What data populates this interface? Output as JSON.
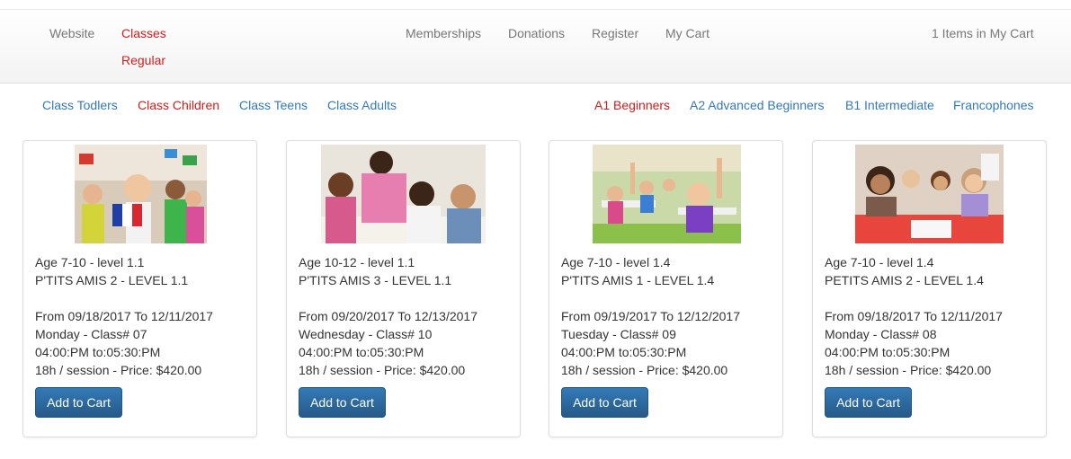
{
  "nav": {
    "website": "Website",
    "classes": "Classes",
    "regular": "Regular",
    "memberships": "Memberships",
    "donations": "Donations",
    "register": "Register",
    "my_cart": "My Cart",
    "cart_count": "1 Items in My Cart"
  },
  "subnav": {
    "left": [
      "Class Todlers",
      "Class Children",
      "Class Teens",
      "Class Adults"
    ],
    "right": [
      "A1 Beginners",
      "A2 Advanced Beginners",
      "B1 Intermediate",
      "Francophones"
    ],
    "active_left": "Class Children",
    "active_right": "A1 Beginners"
  },
  "colors": {
    "active": "#d11c1c",
    "link": "#337ab7",
    "nav_text": "#777777",
    "button": "#2a6aa6"
  },
  "cards": [
    {
      "age": "Age 7-10 - level 1.1",
      "name": "P'TITS AMIS 2 - LEVEL 1.1",
      "dates": "From 09/18/2017 To 12/11/2017",
      "day": "Monday - Class# 07",
      "time": "04:00:PM to:05:30:PM",
      "price": "18h / session - Price: $420.00",
      "button": "Add to Cart"
    },
    {
      "age": "Age 10-12 - level 1.1",
      "name": "P'TITS AMIS 3 - LEVEL 1.1",
      "dates": "From 09/20/2017 To 12/13/2017",
      "day": "Wednesday - Class# 10",
      "time": "04:00:PM to:05:30:PM",
      "price": "18h / session - Price: $420.00",
      "button": "Add to Cart"
    },
    {
      "age": "Age 7-10 - level 1.4",
      "name": "P'TITS AMIS 1 - LEVEL 1.4",
      "dates": "From 09/19/2017 To 12/12/2017",
      "day": "Tuesday - Class# 09",
      "time": "04:00:PM to:05:30:PM",
      "price": "18h / session - Price: $420.00",
      "button": "Add to Cart"
    },
    {
      "age": "Age 7-10 - level 1.4",
      "name": "PETITS AMIS 2 - LEVEL 1.4",
      "dates": "From 09/18/2017 To 12/11/2017",
      "day": "Monday - Class# 08",
      "time": "04:00:PM to:05:30:PM",
      "price": "18h / session - Price: $420.00",
      "button": "Add to Cart"
    }
  ]
}
